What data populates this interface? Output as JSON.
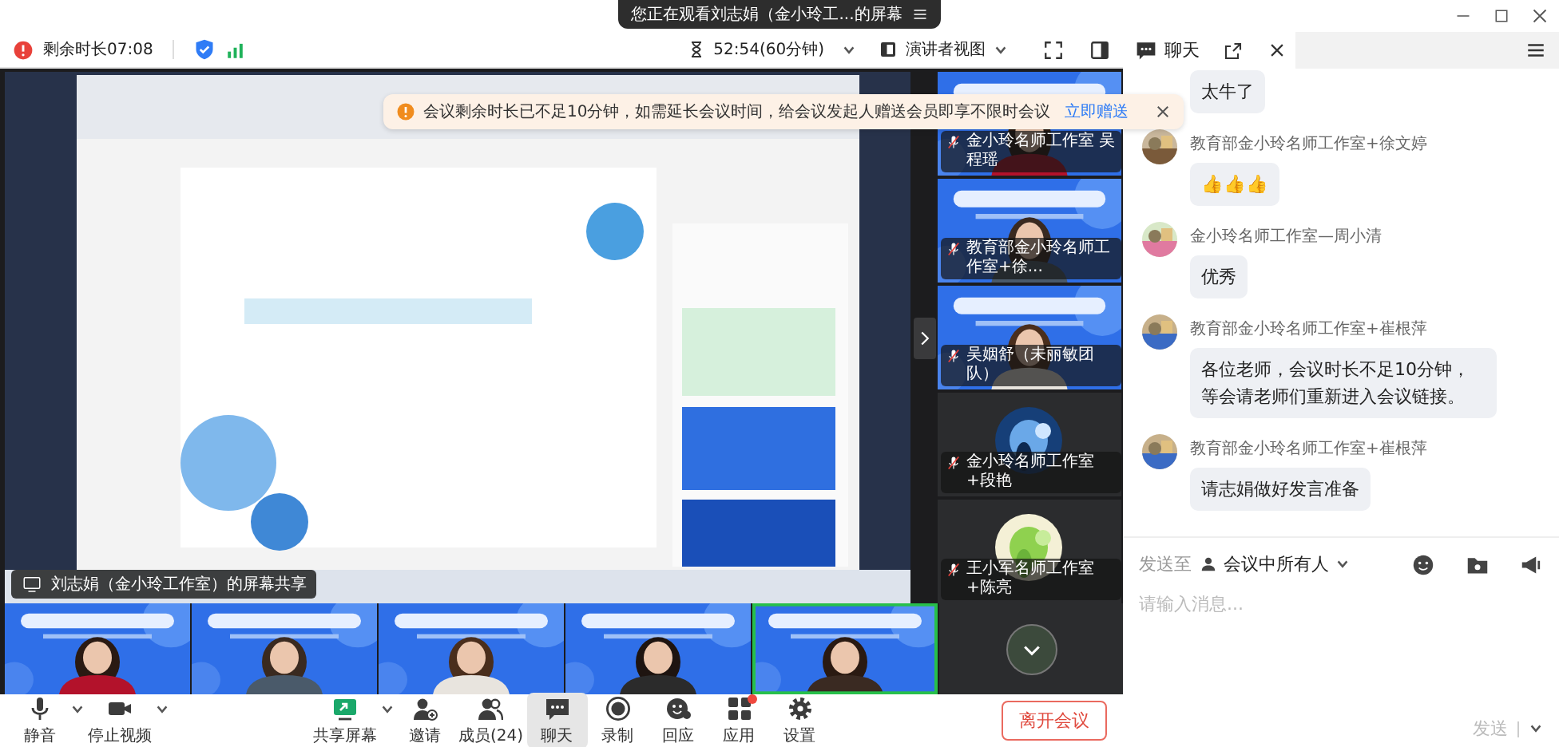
{
  "title_bar": {
    "viewing": "您正在观看刘志娟（金小玲工...的屏幕"
  },
  "top_bar": {
    "remaining": "剩余时长07:08",
    "duration": "52:54(60分钟)",
    "view_mode": "演讲者视图"
  },
  "notice": {
    "text": "会议剩余时长已不足10分钟，如需延长会议时间，给会议发起人赠送会员即享不限时会议",
    "link": "立即赠送"
  },
  "share": {
    "label": "刘志娟（金小玲工作室）的屏幕共享"
  },
  "participants": [
    {
      "name": "金小玲名师工作室 吴程瑶",
      "kind": "video"
    },
    {
      "name": "教育部金小玲名师工作室+徐...",
      "kind": "video"
    },
    {
      "name": "吴姻舒（未丽敏团队）",
      "kind": "video"
    },
    {
      "name": "金小玲名师工作室+段艳",
      "kind": "avatar"
    },
    {
      "name": "王小军名师工作室+陈亮",
      "kind": "avatar"
    }
  ],
  "video_strip": [
    {
      "speaking": false
    },
    {
      "speaking": false
    },
    {
      "speaking": false
    },
    {
      "speaking": false
    },
    {
      "speaking": true
    }
  ],
  "toolbar": [
    {
      "kind": "mic",
      "label": "静音",
      "caret": true,
      "selected": false,
      "badge": false
    },
    {
      "kind": "camera",
      "label": "停止视频",
      "caret": true,
      "selected": false,
      "badge": false
    },
    {
      "kind": "share",
      "label": "共享屏幕",
      "caret": true,
      "selected": false,
      "badge": false
    },
    {
      "kind": "invite",
      "label": "邀请",
      "caret": false,
      "selected": false,
      "badge": false
    },
    {
      "kind": "members",
      "label": "成员(24)",
      "caret": false,
      "selected": false,
      "badge": false
    },
    {
      "kind": "chat",
      "label": "聊天",
      "caret": false,
      "selected": true,
      "badge": false
    },
    {
      "kind": "record",
      "label": "录制",
      "caret": false,
      "selected": false,
      "badge": false
    },
    {
      "kind": "react",
      "label": "回应",
      "caret": false,
      "selected": false,
      "badge": false
    },
    {
      "kind": "apps",
      "label": "应用",
      "caret": false,
      "selected": false,
      "badge": true
    },
    {
      "kind": "settings",
      "label": "设置",
      "caret": false,
      "selected": false,
      "badge": false
    }
  ],
  "leave_button": "离开会议",
  "chat": {
    "title": "聊天",
    "messages": [
      {
        "text": "太牛了"
      },
      {
        "sender": "教育部金小玲名师工作室+徐文婷",
        "text": "👍👍👍"
      },
      {
        "sender": "金小玲名师工作室—周小清",
        "text": "优秀"
      },
      {
        "sender": "教育部金小玲名师工作室+崔根萍",
        "text": "各位老师，会议时长不足10分钟，等会请老师们重新进入会议链接。"
      },
      {
        "sender": "教育部金小玲名师工作室+崔根萍",
        "text": "请志娟做好发言准备"
      }
    ],
    "send_to_label": "发送至",
    "recipient": "会议中所有人",
    "placeholder": "请输入消息...",
    "send": "发送"
  }
}
